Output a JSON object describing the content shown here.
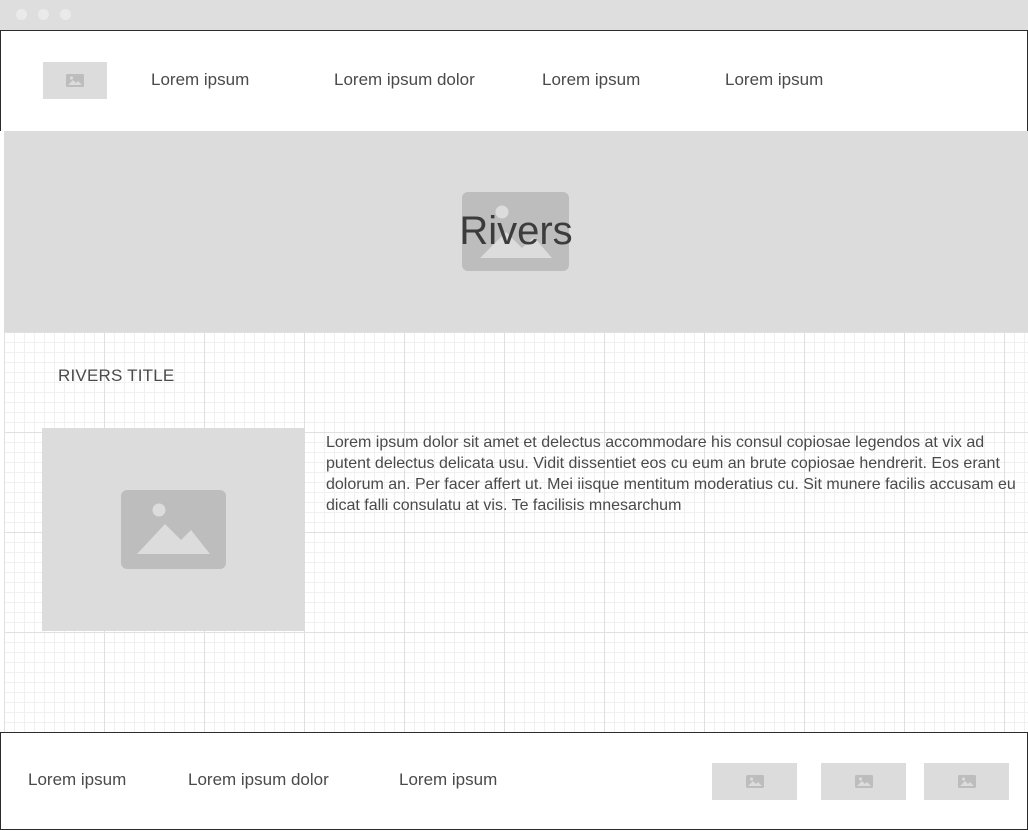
{
  "browser": {
    "dots": [
      "window-dot-1",
      "window-dot-2",
      "window-dot-3"
    ]
  },
  "header": {
    "logo_icon": "image-placeholder-icon",
    "nav": [
      {
        "label": "Lorem ipsum"
      },
      {
        "label": "Lorem ipsum dolor"
      },
      {
        "label": "Lorem ipsum"
      },
      {
        "label": "Lorem ipsum"
      }
    ]
  },
  "hero": {
    "title": "Rivers",
    "image_icon": "image-placeholder-icon"
  },
  "main": {
    "section_title": "RIVERS TITLE",
    "image_icon": "image-placeholder-icon",
    "paragraph": "Lorem ipsum dolor sit amet et delectus accommodare his consul copiosae legendos at vix ad putent delectus delicata usu. Vidit dissentiet eos cu eum an brute copiosae hendrerit. Eos erant dolorum an. Per facer affert ut. Mei iisque mentitum moderatius cu. Sit munere facilis accusam eu dicat falli consulatu at vis. Te facilisis mnesarchum"
  },
  "footer": {
    "links": [
      {
        "label": "Lorem ipsum"
      },
      {
        "label": "Lorem ipsum dolor"
      },
      {
        "label": "Lorem ipsum"
      }
    ],
    "image_icons": [
      "image-placeholder-icon",
      "image-placeholder-icon",
      "image-placeholder-icon"
    ]
  },
  "colors": {
    "placeholder_bg": "#dcdcdc",
    "placeholder_icon": "#bdbdbd",
    "text": "#4a4a4a",
    "border": "#2b2b2b"
  }
}
